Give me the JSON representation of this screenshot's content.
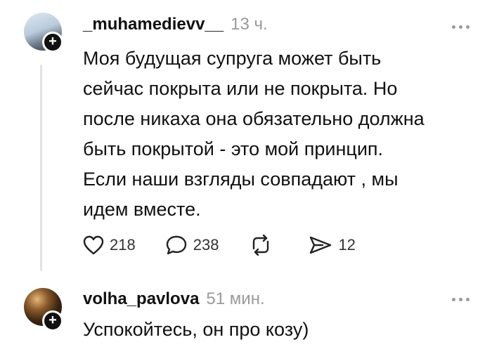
{
  "posts": [
    {
      "username": "_muhamedievv__",
      "time": "13 ч.",
      "lines": [
        "Моя будущая супруга может быть",
        "сейчас покрыта или не покрыта. Но",
        "после никаха она обязательно должна",
        "быть покрытой - это мой принцип.",
        "Если наши взгляды совпадают , мы",
        "идем вместе."
      ],
      "actions": {
        "likes": "218",
        "comments": "238",
        "reposts": "",
        "shares": "12"
      }
    },
    {
      "username": "volha_pavlova",
      "time": "51 мин.",
      "lines": [
        "Успокойтесь, он про козу)"
      ]
    }
  ],
  "badge_symbol": "+",
  "icons": {
    "like": "heart-icon",
    "comment": "comment-bubble-icon",
    "repost": "repost-icon",
    "share": "send-icon",
    "more": "more-dots-icon"
  },
  "colors": {
    "text": "#111111",
    "muted": "#9a9a9a",
    "thread_line": "#e2e2e2"
  }
}
